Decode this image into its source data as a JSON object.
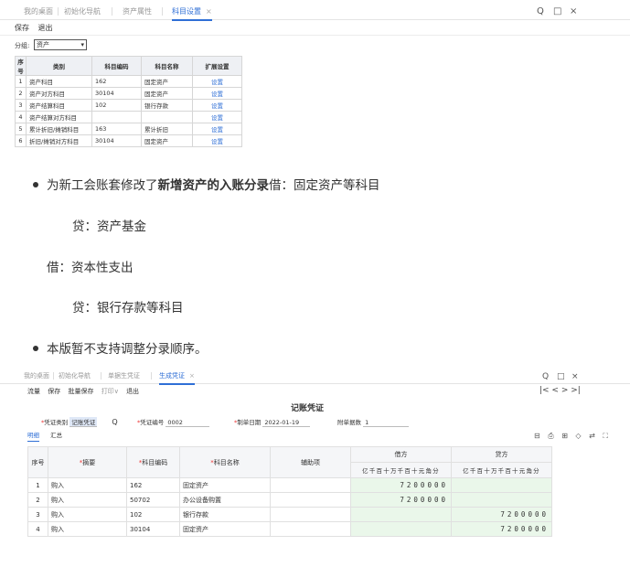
{
  "shot1": {
    "tabs": [
      "我的桌面",
      "初始化导航",
      "资产属性",
      "科目设置"
    ],
    "close_glyph": "×",
    "window_controls": [
      "Q",
      "□",
      "×"
    ],
    "toolbar": [
      "保存",
      "退出"
    ],
    "group_label": "分组:",
    "group_value": "资产",
    "headers": [
      "序号",
      "类别",
      "科目编码",
      "科目名称",
      "扩展设置"
    ],
    "rows": [
      {
        "n": "1",
        "cat": "资产科目",
        "code": "162",
        "name": "固定资产",
        "link": "设置"
      },
      {
        "n": "2",
        "cat": "资产对方科目",
        "code": "30104",
        "name": "固定资产",
        "link": "设置"
      },
      {
        "n": "3",
        "cat": "资产结算科目",
        "code": "102",
        "name": "银行存款",
        "link": "设置"
      },
      {
        "n": "4",
        "cat": "资产结算对方科目",
        "code": "",
        "name": "",
        "link": "设置"
      },
      {
        "n": "5",
        "cat": "累计折旧/摊销科目",
        "code": "163",
        "name": "累计折旧",
        "link": "设置"
      },
      {
        "n": "6",
        "cat": "折旧/摊销对方科目",
        "code": "30104",
        "name": "固定资产",
        "link": "设置"
      }
    ]
  },
  "text": {
    "p1_pre": "为新工会账套修改了",
    "p1_bold": "新增资产的入账分录",
    "p1_post": "借：固定资产等科目",
    "p2": "贷：资产基金",
    "p3": "借：资本性支出",
    "p4": "贷：银行存款等科目",
    "p5": "本版暂不支持调整分录顺序。"
  },
  "shot2": {
    "tabs": [
      "我的桌面",
      "初始化导航",
      "单据生凭证",
      "生成凭证"
    ],
    "close_glyph": "×",
    "window_controls": [
      "Q",
      "□",
      "×"
    ],
    "toolbar": [
      "流量",
      "保存",
      "批量保存",
      "打印∨",
      "退出"
    ],
    "pager": "|<  <  >  >|",
    "title": "记账凭证",
    "voucher_type_label": "凭证类别",
    "voucher_type": "记账凭证",
    "voucher_no_label": "凭证编号",
    "voucher_no": "0002",
    "date_label": "制单日期",
    "date": "2022-01-19",
    "attach_label": "附单据数",
    "attach": "1",
    "subtabs": [
      "明细",
      "汇总"
    ],
    "toolicons": "⊟ ⎙ ⊞ ◇ ⇄ ⛶",
    "headers": {
      "n": "序号",
      "summary": "摘要",
      "code": "科目编码",
      "name": "科目名称",
      "aux": "辅助项",
      "debit": "借方",
      "credit": "贷方",
      "digits": "亿千百十万千百十元角分"
    },
    "rows": [
      {
        "n": "1",
        "summary": "购入",
        "code": "162",
        "name": "固定资产",
        "debit": "7200000",
        "credit": ""
      },
      {
        "n": "2",
        "summary": "购入",
        "code": "50702",
        "name": "办公设备购置",
        "debit": "7200000",
        "credit": ""
      },
      {
        "n": "3",
        "summary": "购入",
        "code": "102",
        "name": "银行存款",
        "debit": "",
        "credit": "7200000"
      },
      {
        "n": "4",
        "summary": "购入",
        "code": "30104",
        "name": "固定资产",
        "debit": "",
        "credit": "7200000"
      }
    ]
  }
}
